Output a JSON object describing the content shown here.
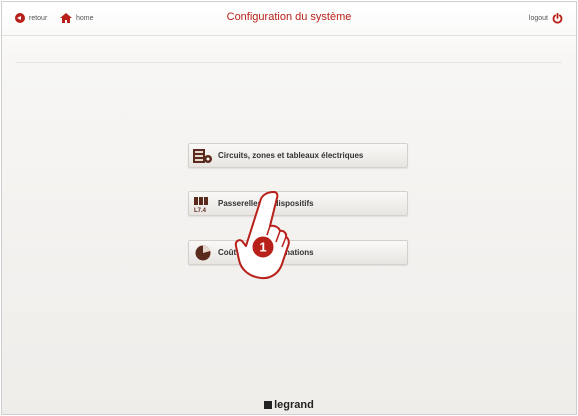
{
  "header": {
    "title": "Configuration du système",
    "back_label": "retour",
    "home_label": "home",
    "logout_label": "logout"
  },
  "menu": [
    {
      "label": "Circuits, zones et tableaux électriques",
      "icon": "panel-gear-icon"
    },
    {
      "label": "Passerelles et dispositifs",
      "icon": "devices-icon"
    },
    {
      "label": "Coûts et consommations",
      "icon": "pie-chart-icon"
    }
  ],
  "callout": {
    "number": "1"
  },
  "footer": {
    "logo_text": "legrand"
  },
  "colors": {
    "accent": "#b8201a",
    "button_top": "#faf9f7",
    "button_bottom": "#e8e5e1"
  }
}
